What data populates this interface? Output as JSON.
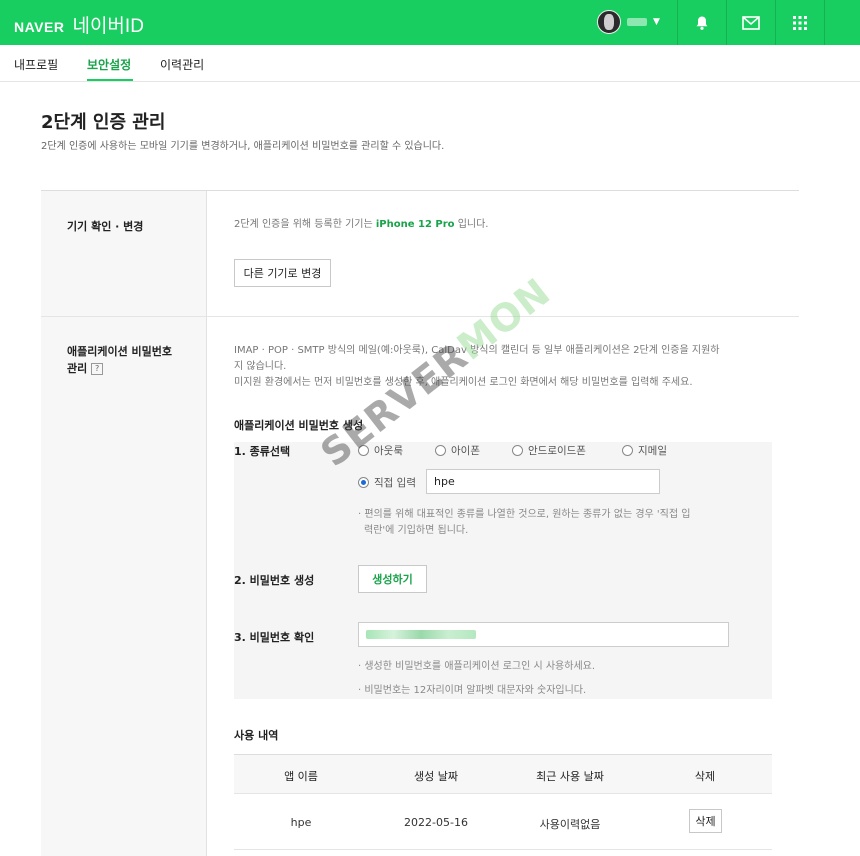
{
  "header": {
    "brand": "NAVER",
    "service": "네이버ID"
  },
  "tabs": [
    {
      "label": "내프로필"
    },
    {
      "label": "보안설정"
    },
    {
      "label": "이력관리"
    }
  ],
  "page": {
    "title": "2단계 인증 관리",
    "description": "2단계 인증에 사용하는 모바일 기기를 변경하거나, 애플리케이션 비밀번호를 관리할 수 있습니다."
  },
  "device": {
    "label": "기기 확인 · 변경",
    "text_before": "2단계 인증을 위해 등록한 기기는 ",
    "device_name": "iPhone 12 Pro",
    "text_after": " 입니다.",
    "change_button": "다른 기기로 변경"
  },
  "app_password": {
    "label_line1": "애플리케이션 비밀번호",
    "label_line2": "관리",
    "help_icon": "?",
    "desc_line1": "IMAP · POP · SMTP 방식의 메일(예:아웃룩), CalDav 방식의 캘린더 등 일부 애플리케이션은 2단계 인증을 지원하",
    "desc_line2": "지 않습니다.",
    "desc_line3": "미지원 환경에서는 먼저 비밀번호를 생성한 후, 애플리케이션 로그인 화면에서 해당 비밀번호를 입력해 주세요.",
    "gen_title": "애플리케이션 비밀번호 생성",
    "step1": "1. 종류선택",
    "options": [
      "아웃룩",
      "아이폰",
      "안드로이드폰",
      "지메일"
    ],
    "custom_option": "직접 입력",
    "custom_value": "hpe",
    "step1_note_line1": "· 편의를 위해 대표적인 종류를 나열한 것으로, 원하는 종류가 없는 경우 '직접 입",
    "step1_note_line2": "력란'에 기입하면 됩니다.",
    "step2": "2. 비밀번호 생성",
    "generate_button": "생성하기",
    "step3": "3. 비밀번호 확인",
    "note1": "· 생성한 비밀번호를 애플리케이션 로그인 시 사용하세요.",
    "note2": "· 비밀번호는 12자리이며 알파벳 대문자와 숫자입니다."
  },
  "history": {
    "title": "사용 내역",
    "columns": [
      "앱 이름",
      "생성 날짜",
      "최근 사용 날짜",
      "삭제"
    ],
    "rows": [
      {
        "app": "hpe",
        "created": "2022-05-16",
        "last_used": "사용이력없음",
        "delete": "삭제"
      }
    ]
  },
  "watermark": {
    "part1": "SERVER",
    "part2": "MON"
  },
  "colors": {
    "brand_green": "#19ce60",
    "active_tab": "#19a34a",
    "highlight": "#19a34a"
  }
}
